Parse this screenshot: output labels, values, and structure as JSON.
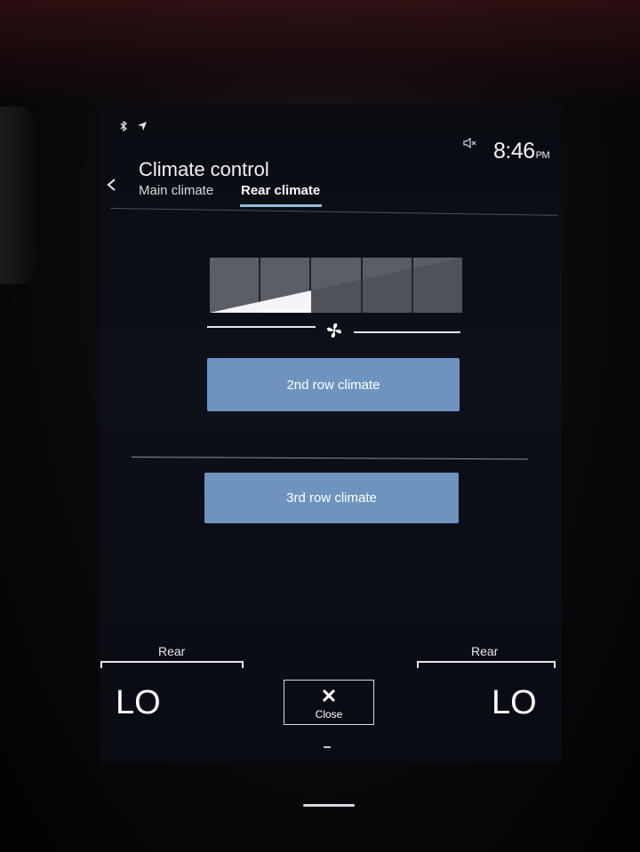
{
  "status_bar": {
    "bluetooth_icon": "bluetooth-icon",
    "location_icon": "navigation-arrow-icon",
    "mute_icon": "speaker-muted-icon",
    "time": "8:46",
    "ampm": "PM"
  },
  "header": {
    "title": "Climate control",
    "back_icon": "chevron-left-icon",
    "tabs": [
      {
        "label": "Main climate",
        "active": false
      },
      {
        "label": "Rear climate",
        "active": true
      }
    ]
  },
  "fan": {
    "levels": 5,
    "current_level": 2,
    "icon": "fan-icon"
  },
  "buttons": {
    "second_row": "2nd row climate",
    "third_row": "3rd row climate"
  },
  "bottom_bar": {
    "left": {
      "zone_label": "Rear",
      "temperature": "LO"
    },
    "right": {
      "zone_label": "Rear",
      "temperature": "LO"
    },
    "close": {
      "label": "Close",
      "icon": "close-x-icon"
    }
  },
  "colors": {
    "button_blue": "#6f93bf",
    "tab_underline": "#8fb6dd",
    "screen_bg": "#0d1019"
  }
}
